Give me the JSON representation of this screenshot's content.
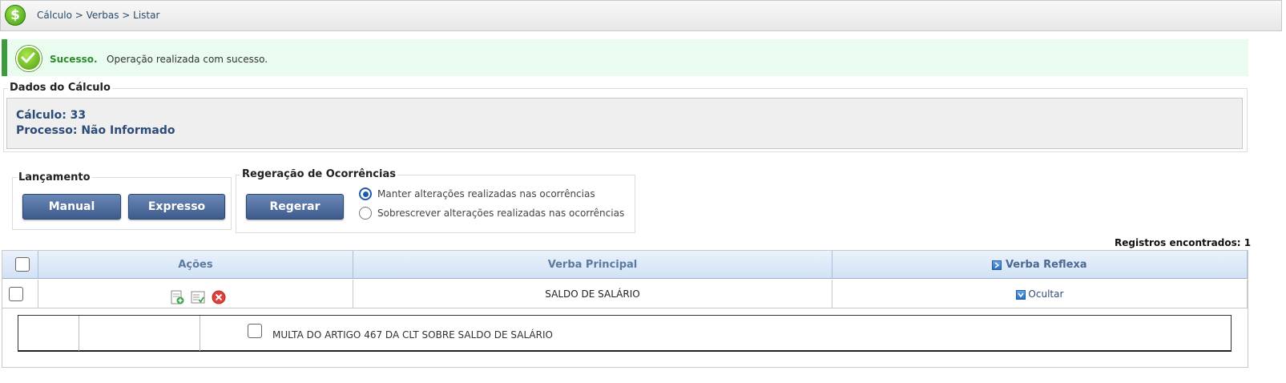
{
  "breadcrumb": "Cálculo > Verbas > Listar",
  "alert": {
    "title": "Sucesso.",
    "message": "Operação realizada com sucesso."
  },
  "dados_calculo": {
    "legend": "Dados do Cálculo",
    "calculo": "Cálculo: 33",
    "processo": "Processo: Não Informado"
  },
  "lancamento": {
    "legend": "Lançamento",
    "manual": "Manual",
    "expresso": "Expresso"
  },
  "regeracao": {
    "legend": "Regeração de Ocorrências",
    "button": "Regerar",
    "options": [
      {
        "label": "Manter alterações realizadas nas ocorrências",
        "checked": true
      },
      {
        "label": "Sobrescrever alterações realizadas nas ocorrências",
        "checked": false
      }
    ]
  },
  "registros": "Registros encontrados: 1",
  "table": {
    "headers": {
      "acoes": "Ações",
      "verba_principal": "Verba Principal",
      "verba_reflexa": "Verba Reflexa"
    },
    "rows": [
      {
        "verba_principal": "SALDO DE SALÁRIO",
        "reflexa_action": "Ocultar"
      }
    ],
    "sub_rows": [
      {
        "label": "MULTA DO ARTIGO 467 DA CLT SOBRE SALDO DE SALÁRIO"
      }
    ]
  },
  "colors": {
    "accent": "#3e5b8d",
    "success": "#3d9a3d",
    "header_text": "#5b7aa0"
  },
  "icons": [
    "dollar-icon",
    "success-check-icon",
    "edit-document-icon",
    "list-check-icon",
    "delete-icon",
    "expand-icon",
    "collapse-icon"
  ]
}
